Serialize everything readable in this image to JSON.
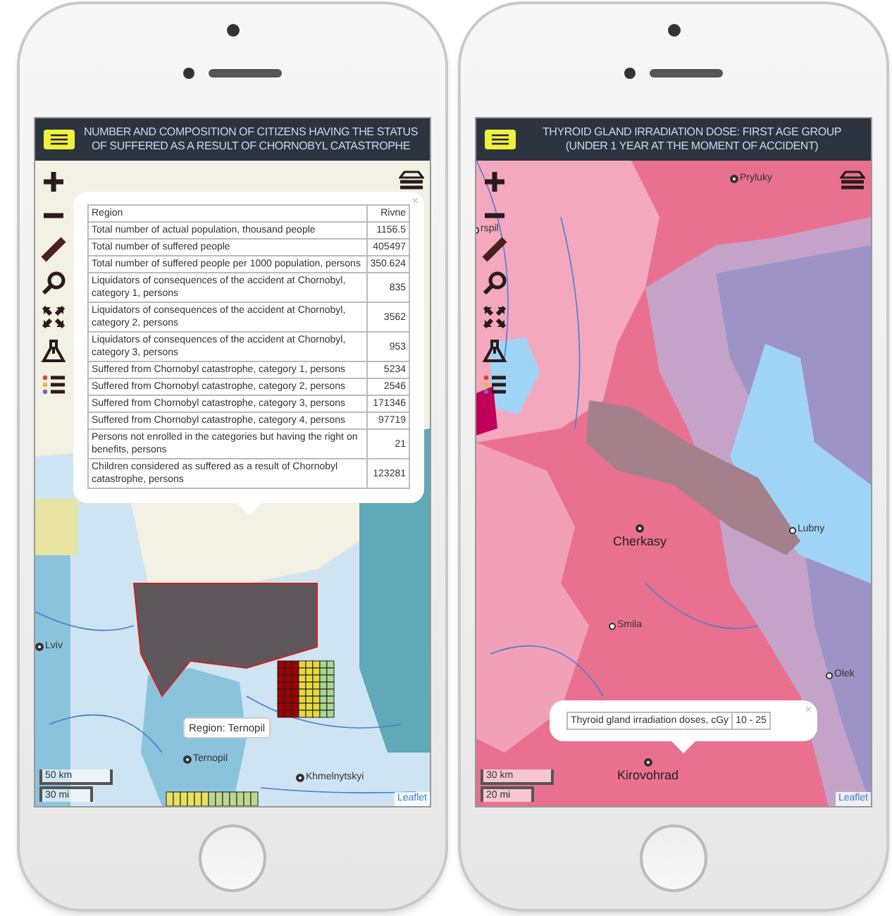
{
  "phones": [
    {
      "header": {
        "title": "NUMBER AND COMPOSITION OF CITIZENS HAVING THE STATUS OF SUFFERED AS A RESULT OF CHORNOBYL CATASTROPHE"
      },
      "map": {
        "places": [
          "Lviv",
          "Ternopil",
          "Khmelnytskyi"
        ],
        "tooltip": "Region: Ternopil",
        "scale": [
          "50 km",
          "30 mi"
        ],
        "attribution": "Leaflet"
      },
      "popup": {
        "close": "×",
        "rows": [
          [
            "Region",
            "Rivne"
          ],
          [
            "Total number of actual population, thousand people",
            "1156.5"
          ],
          [
            "Total number of suffered people",
            "405497"
          ],
          [
            "Total number of suffered people per 1000 population, persons",
            "350.624"
          ],
          [
            "Liquidators of consequences of the accident at Chornobyl, category 1, persons",
            "835"
          ],
          [
            "Liquidators of consequences of the accident at Chornobyl, category 2, persons",
            "3562"
          ],
          [
            "Liquidators of consequences of the accident at Chornobyl, category 3, persons",
            "953"
          ],
          [
            "Suffered from Chornobyl catastrophe, category 1, persons",
            "5234"
          ],
          [
            "Suffered from Chornobyl catastrophe, category 2, persons",
            "2546"
          ],
          [
            "Suffered from Chornobyl catastrophe, category 3, persons",
            "171346"
          ],
          [
            "Suffered from Chornobyl catastrophe, category 4, persons",
            "97719"
          ],
          [
            "Persons not enrolled in the categories but having the right on benefits, persons",
            "21"
          ],
          [
            "Children considered as suffered as a result of Chornobyl catastrophe, persons",
            "123281"
          ]
        ]
      }
    },
    {
      "header": {
        "title": "THYROID GLAND IRRADIATION DOSE: FIRST AGE GROUP (UNDER 1 YEAR AT THE MOMENT OF ACCIDENT)"
      },
      "map": {
        "places": [
          "Pryluky",
          "rspil",
          "Lubny",
          "Cherkasy",
          "Smila",
          "Olek",
          "Kirovohrad"
        ],
        "scale": [
          "30 km",
          "20 mi"
        ],
        "attribution": "Leaflet"
      },
      "popup": {
        "close": "×",
        "rows": [
          [
            "Thyroid gland irradiation doses, cGy",
            "10 - 25"
          ]
        ]
      }
    }
  ]
}
